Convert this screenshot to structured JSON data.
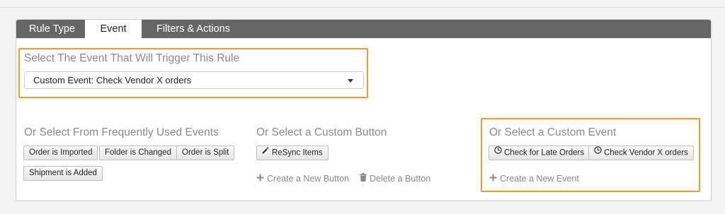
{
  "tabs": [
    "Rule Type",
    "Event",
    "Filters & Actions"
  ],
  "active_tab": "Event",
  "trigger_section": {
    "title": "Select The Event That Will Trigger This Rule",
    "selected_event": "Custom Event: Check Vendor X orders"
  },
  "frequent_events": {
    "title": "Or Select From Frequently Used Events",
    "buttons": [
      "Order is Imported",
      "Folder is Changed",
      "Order is Split",
      "Shipment is Added"
    ]
  },
  "custom_button": {
    "title": "Or Select a Custom Button",
    "buttons": [
      "ReSync Items"
    ],
    "create_label": "Create a New Button",
    "delete_label": "Delete a Button"
  },
  "custom_event": {
    "title": "Or Select a Custom Event",
    "buttons": [
      "Check for Late Orders",
      "Check Vendor X orders"
    ],
    "create_label": "Create a New Event"
  },
  "colors": {
    "highlight": "#f09a34",
    "tabbar": "#666666",
    "muted_text": "#8a8a8a"
  }
}
